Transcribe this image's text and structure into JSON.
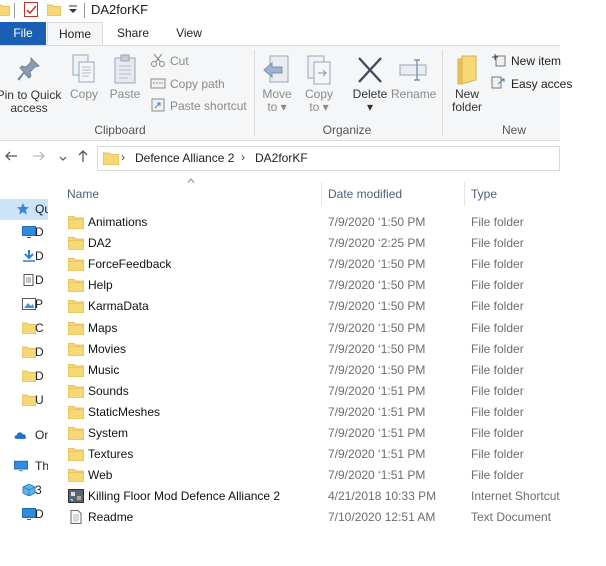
{
  "window": {
    "title": "DA2forKF"
  },
  "tabs": [
    {
      "label": "File"
    },
    {
      "label": "Home"
    },
    {
      "label": "Share"
    },
    {
      "label": "View"
    }
  ],
  "ribbon": {
    "clipboard": {
      "pin_label_1": "Pin to Quick",
      "pin_label_2": "access",
      "copy_label": "Copy",
      "paste_label": "Paste",
      "cut_label": "Cut",
      "copy_path_label": "Copy path",
      "paste_shortcut_label": "Paste shortcut",
      "group_label": "Clipboard"
    },
    "organize": {
      "move_to_label": "Move",
      "move_to_label_2": "to",
      "copy_to_label": "Copy",
      "copy_to_label_2": "to",
      "delete_label": "Delete",
      "rename_label": "Rename",
      "group_label": "Organize"
    },
    "new": {
      "new_folder_label_1": "New",
      "new_folder_label_2": "folder",
      "new_item_label": "New item",
      "easy_access_label": "Easy acces",
      "group_label": "New"
    }
  },
  "address": {
    "crumbs": [
      "Defence Alliance 2",
      "DA2forKF"
    ]
  },
  "nav_pane": [
    {
      "label": "Qu",
      "icon": "quick-access-star-icon",
      "selected": true
    },
    {
      "label": "D",
      "icon": "desktop-icon"
    },
    {
      "label": "D",
      "icon": "downloads-icon"
    },
    {
      "label": "D",
      "icon": "documents-icon"
    },
    {
      "label": "P",
      "icon": "pictures-icon"
    },
    {
      "label": "C",
      "icon": "folder-icon"
    },
    {
      "label": "D",
      "icon": "folder-icon"
    },
    {
      "label": "D",
      "icon": "folder-icon"
    },
    {
      "label": "U",
      "icon": "folder-icon"
    },
    {
      "label": "On",
      "icon": "onedrive-icon"
    },
    {
      "label": "Th",
      "icon": "this-pc-icon"
    },
    {
      "label": "3",
      "icon": "3d-objects-icon"
    },
    {
      "label": "D",
      "icon": "desktop-icon"
    }
  ],
  "columns": {
    "name": "Name",
    "date": "Date modified",
    "type": "Type"
  },
  "files": [
    {
      "name": "Animations",
      "date": "7/9/2020 ‘1:50 PM",
      "type": "File folder",
      "icon": "folder-icon"
    },
    {
      "name": "DA2",
      "date": "7/9/2020 ‘2:25 PM",
      "type": "File folder",
      "icon": "folder-icon"
    },
    {
      "name": "ForceFeedback",
      "date": "7/9/2020 ‘1:50 PM",
      "type": "File folder",
      "icon": "folder-icon"
    },
    {
      "name": "Help",
      "date": "7/9/2020 ‘1:50 PM",
      "type": "File folder",
      "icon": "folder-icon"
    },
    {
      "name": "KarmaData",
      "date": "7/9/2020 ‘1:50 PM",
      "type": "File folder",
      "icon": "folder-icon"
    },
    {
      "name": "Maps",
      "date": "7/9/2020 ‘1:50 PM",
      "type": "File folder",
      "icon": "folder-icon"
    },
    {
      "name": "Movies",
      "date": "7/9/2020 ‘1:50 PM",
      "type": "File folder",
      "icon": "folder-icon"
    },
    {
      "name": "Music",
      "date": "7/9/2020 ‘1:50 PM",
      "type": "File folder",
      "icon": "folder-icon"
    },
    {
      "name": "Sounds",
      "date": "7/9/2020 ‘1:51 PM",
      "type": "File folder",
      "icon": "folder-icon"
    },
    {
      "name": "StaticMeshes",
      "date": "7/9/2020 ‘1:51 PM",
      "type": "File folder",
      "icon": "folder-icon"
    },
    {
      "name": "System",
      "date": "7/9/2020 ‘1:51 PM",
      "type": "File folder",
      "icon": "folder-icon"
    },
    {
      "name": "Textures",
      "date": "7/9/2020 ‘1:51 PM",
      "type": "File folder",
      "icon": "folder-icon"
    },
    {
      "name": "Web",
      "date": "7/9/2020 ‘1:51 PM",
      "type": "File folder",
      "icon": "folder-icon"
    },
    {
      "name": "Killing Floor Mod Defence Alliance 2",
      "date": "4/21/2018 10:33 PM",
      "type": "Internet Shortcut",
      "icon": "internet-shortcut-icon"
    },
    {
      "name": "Readme",
      "date": "7/10/2020 12:51 AM",
      "type": "Text Document",
      "icon": "text-document-icon"
    }
  ],
  "colors": {
    "accent": "#1a5fb4",
    "folder_yellow": "#f8d775",
    "selection": "#cce4f7"
  }
}
